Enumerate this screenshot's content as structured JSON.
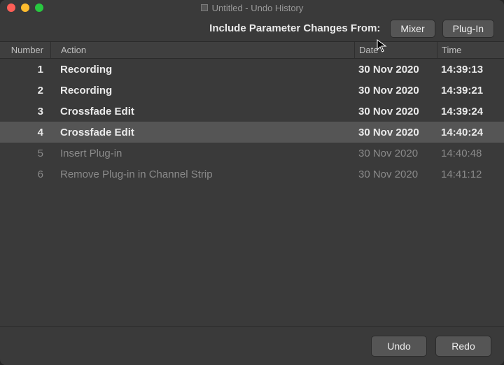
{
  "window": {
    "title": "Untitled - Undo History"
  },
  "toolbar": {
    "label": "Include Parameter Changes From:",
    "mixer_label": "Mixer",
    "plugin_label": "Plug-In"
  },
  "columns": {
    "number": "Number",
    "action": "Action",
    "date": "Date",
    "time": "Time"
  },
  "history": [
    {
      "num": "1",
      "action": "Recording",
      "date": "30 Nov 2020",
      "time": "14:39:13",
      "state": "past"
    },
    {
      "num": "2",
      "action": "Recording",
      "date": "30 Nov 2020",
      "time": "14:39:21",
      "state": "past"
    },
    {
      "num": "3",
      "action": "Crossfade Edit",
      "date": "30 Nov 2020",
      "time": "14:39:24",
      "state": "past"
    },
    {
      "num": "4",
      "action": "Crossfade Edit",
      "date": "30 Nov 2020",
      "time": "14:40:24",
      "state": "selected"
    },
    {
      "num": "5",
      "action": "Insert Plug-in",
      "date": "30 Nov 2020",
      "time": "14:40:48",
      "state": "future"
    },
    {
      "num": "6",
      "action": "Remove Plug-in in Channel Strip",
      "date": "30 Nov 2020",
      "time": "14:41:12",
      "state": "future"
    }
  ],
  "footer": {
    "undo_label": "Undo",
    "redo_label": "Redo"
  }
}
